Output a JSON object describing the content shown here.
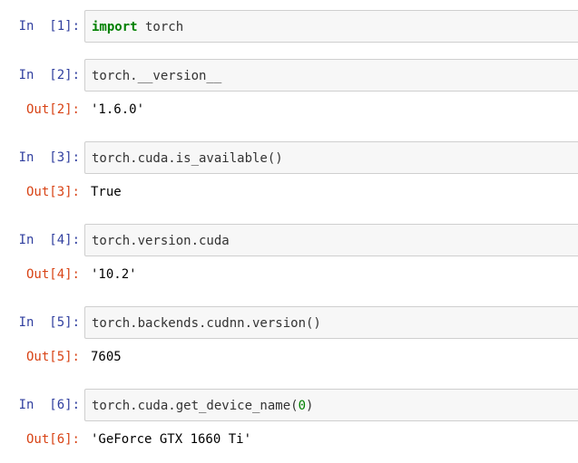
{
  "cells": [
    {
      "in_prompt": "In  [1]:",
      "code": {
        "keyword": "import",
        "text": " torch"
      }
    },
    {
      "in_prompt": "In  [2]:",
      "code": {
        "text": "torch.__version__"
      },
      "out_prompt": "Out[2]:",
      "output": "'1.6.0'"
    },
    {
      "in_prompt": "In  [3]:",
      "code": {
        "text": "torch.cuda.is_available()"
      },
      "out_prompt": "Out[3]:",
      "output": "True"
    },
    {
      "in_prompt": "In  [4]:",
      "code": {
        "text": "torch.version.cuda"
      },
      "out_prompt": "Out[4]:",
      "output": "'10.2'"
    },
    {
      "in_prompt": "In  [5]:",
      "code": {
        "text": "torch.backends.cudnn.version()"
      },
      "out_prompt": "Out[5]:",
      "output": "7605"
    },
    {
      "in_prompt": "In  [6]:",
      "code": {
        "text_before": "torch.cuda.get_device_name(",
        "number": "0",
        "text_after": ")"
      },
      "out_prompt": "Out[6]:",
      "output": "'GeForce GTX 1660 Ti'"
    }
  ],
  "colors": {
    "in_prompt": "#303f9f",
    "out_prompt": "#d84315",
    "keyword": "#008000",
    "cell_background": "#f7f7f7",
    "cell_border": "#cfcfcf"
  }
}
